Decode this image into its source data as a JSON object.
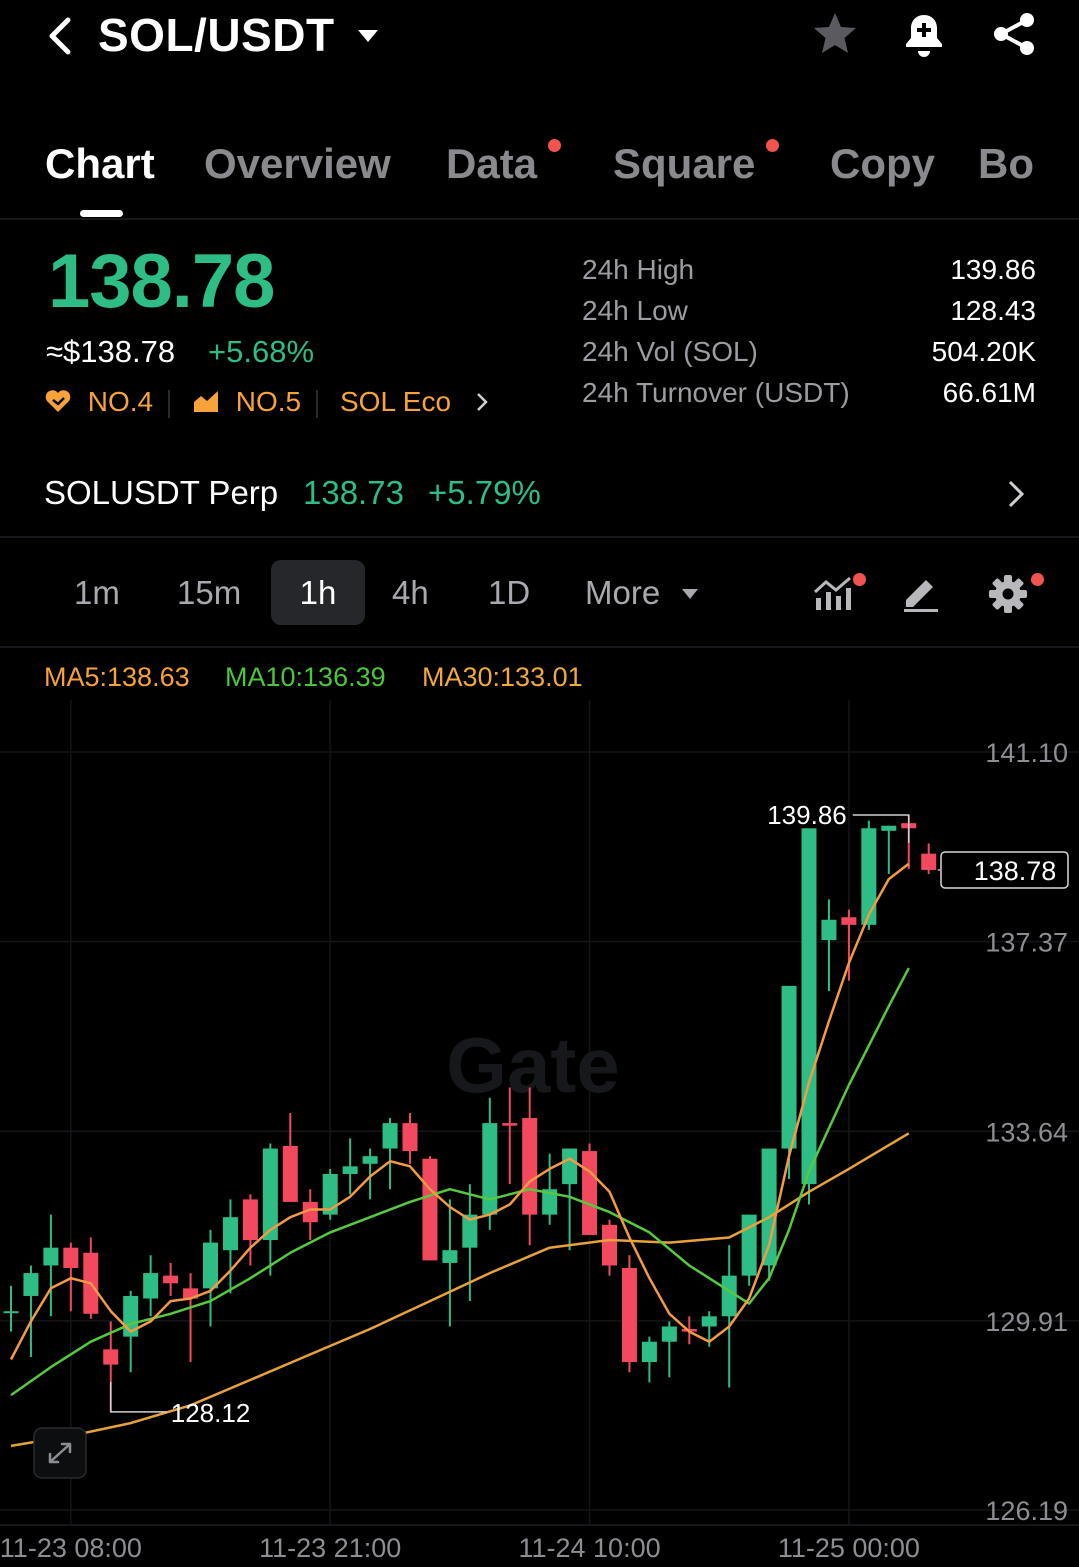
{
  "header": {
    "title": "SOL/USDT",
    "icons": [
      "back-icon",
      "dropdown-caret-icon",
      "star-icon",
      "bell-plus-icon",
      "share-icon"
    ]
  },
  "tabs": [
    {
      "label": "Chart",
      "active": true,
      "dot": false
    },
    {
      "label": "Overview",
      "active": false,
      "dot": false
    },
    {
      "label": "Data",
      "active": false,
      "dot": true
    },
    {
      "label": "Square",
      "active": false,
      "dot": true
    },
    {
      "label": "Copy",
      "active": false,
      "dot": false
    },
    {
      "label": "Bo",
      "active": false,
      "dot": false
    }
  ],
  "ticker": {
    "last_price": "138.78",
    "usd_price": "≈$138.78",
    "change_pct": "+5.68%",
    "badges": [
      {
        "icon": "heart-hand-icon",
        "label": "NO.4"
      },
      {
        "icon": "chart-rise-icon",
        "label": "NO.5"
      },
      {
        "icon": "",
        "label": "SOL Eco"
      }
    ],
    "stats": [
      {
        "label": "24h High",
        "value": "139.86"
      },
      {
        "label": "24h Low",
        "value": "128.43"
      },
      {
        "label": "24h Vol (SOL)",
        "value": "504.20K"
      },
      {
        "label": "24h Turnover (USDT)",
        "value": "66.61M"
      }
    ]
  },
  "perp": {
    "name": "SOLUSDT Perp",
    "price": "138.73",
    "change": "+5.79%"
  },
  "intervals": [
    {
      "label": "1m",
      "selected": false
    },
    {
      "label": "15m",
      "selected": false
    },
    {
      "label": "1h",
      "selected": true
    },
    {
      "label": "4h",
      "selected": false
    },
    {
      "label": "1D",
      "selected": false
    },
    {
      "label": "More",
      "selected": false
    }
  ],
  "chart_tools": [
    "indicators-icon",
    "draw-pencil-icon",
    "settings-gear-icon"
  ],
  "ma_labels": [
    {
      "text": "MA5:138.63",
      "color": "#f7a23b"
    },
    {
      "text": "MA10:136.39",
      "color": "#4cc63a"
    },
    {
      "text": "MA30:133.01",
      "color": "#f2a93b"
    }
  ],
  "colors": {
    "up": "#2ebd85",
    "down": "#f2495e",
    "ma5": "#f29a45",
    "ma10": "#56c940",
    "ma30": "#e8a23a"
  },
  "chart_data": {
    "type": "candlestick",
    "watermark": "Gate",
    "y_ticks": [
      141.1,
      137.37,
      133.64,
      129.91,
      126.19
    ],
    "ylim": [
      126.19,
      141.1
    ],
    "x_tick_labels": [
      "11-23 08:00",
      "11-23 21:00",
      "11-24 10:00",
      "11-25 00:00"
    ],
    "x_tick_index": [
      3,
      16,
      29,
      42
    ],
    "max_label": "139.86",
    "min_label": "128.12",
    "current_price_label": "138.78",
    "ohlc": [
      [
        130.1,
        130.6,
        129.7,
        130.1
      ],
      [
        130.4,
        131.0,
        129.2,
        130.85
      ],
      [
        131.0,
        132.0,
        130.0,
        131.35
      ],
      [
        131.35,
        131.45,
        130.1,
        130.95
      ],
      [
        131.25,
        131.55,
        129.95,
        130.05
      ],
      [
        129.35,
        129.9,
        128.12,
        129.05
      ],
      [
        129.6,
        130.5,
        128.9,
        130.4
      ],
      [
        130.35,
        131.2,
        130.0,
        130.85
      ],
      [
        130.8,
        131.05,
        130.4,
        130.65
      ],
      [
        130.55,
        130.85,
        129.1,
        130.35
      ],
      [
        130.55,
        131.7,
        129.8,
        131.45
      ],
      [
        131.3,
        132.3,
        130.45,
        131.95
      ],
      [
        132.3,
        132.4,
        131.0,
        131.5
      ],
      [
        131.5,
        133.4,
        130.8,
        133.3
      ],
      [
        133.35,
        134.0,
        132.6,
        132.25
      ],
      [
        132.25,
        132.5,
        131.5,
        131.85
      ],
      [
        132.0,
        132.9,
        131.9,
        132.8
      ],
      [
        132.8,
        133.5,
        132.4,
        132.95
      ],
      [
        133.0,
        133.3,
        132.3,
        133.15
      ],
      [
        133.3,
        133.9,
        132.5,
        133.8
      ],
      [
        133.8,
        134.0,
        133.0,
        133.25
      ],
      [
        133.1,
        133.15,
        131.1,
        131.1
      ],
      [
        131.05,
        132.3,
        129.8,
        131.3
      ],
      [
        131.35,
        132.6,
        130.3,
        132.0
      ],
      [
        132.0,
        134.3,
        131.7,
        133.8
      ],
      [
        133.8,
        134.5,
        132.6,
        133.75
      ],
      [
        133.9,
        134.5,
        131.4,
        132.0
      ],
      [
        132.0,
        133.2,
        131.8,
        132.5
      ],
      [
        132.6,
        133.3,
        131.3,
        133.3
      ],
      [
        133.25,
        133.4,
        131.6,
        131.6
      ],
      [
        131.8,
        131.9,
        130.8,
        131.0
      ],
      [
        130.95,
        131.2,
        128.9,
        129.1
      ],
      [
        129.1,
        129.6,
        128.7,
        129.5
      ],
      [
        129.5,
        129.9,
        128.8,
        129.8
      ],
      [
        129.75,
        130.0,
        129.45,
        129.7
      ],
      [
        129.8,
        130.1,
        129.4,
        130.0
      ],
      [
        130.0,
        131.4,
        128.6,
        130.8
      ],
      [
        130.8,
        132.0,
        130.6,
        132.0
      ],
      [
        131.0,
        132.5,
        130.7,
        133.3
      ],
      [
        133.3,
        135.0,
        132.7,
        136.5
      ],
      [
        132.6,
        136.5,
        132.2,
        139.6
      ],
      [
        137.4,
        138.2,
        136.4,
        137.8
      ],
      [
        137.85,
        138.0,
        136.6,
        137.7
      ],
      [
        137.7,
        139.75,
        137.6,
        139.6
      ],
      [
        139.55,
        139.6,
        138.7,
        139.65
      ],
      [
        139.7,
        139.86,
        138.8,
        139.6
      ],
      [
        139.1,
        139.3,
        138.7,
        138.78
      ]
    ],
    "ma5": [
      [
        0,
        129.15
      ],
      [
        1,
        129.9
      ],
      [
        2,
        130.55
      ],
      [
        3,
        130.75
      ],
      [
        4,
        130.65
      ],
      [
        5,
        130.1
      ],
      [
        6,
        129.7
      ],
      [
        7,
        129.9
      ],
      [
        8,
        130.3
      ],
      [
        9,
        130.35
      ],
      [
        10,
        130.5
      ],
      [
        11,
        130.9
      ],
      [
        12,
        131.35
      ],
      [
        13,
        131.7
      ],
      [
        14,
        131.95
      ],
      [
        15,
        132.1
      ],
      [
        16,
        132.1
      ],
      [
        17,
        132.35
      ],
      [
        18,
        132.75
      ],
      [
        19,
        133.05
      ],
      [
        20,
        132.95
      ],
      [
        21,
        132.5
      ],
      [
        22,
        132.15
      ],
      [
        23,
        131.9
      ],
      [
        24,
        132.0
      ],
      [
        25,
        132.2
      ],
      [
        26,
        132.65
      ],
      [
        27,
        132.9
      ],
      [
        28,
        133.1
      ],
      [
        29,
        132.85
      ],
      [
        30,
        132.45
      ],
      [
        31,
        131.55
      ],
      [
        32,
        130.75
      ],
      [
        33,
        130.05
      ],
      [
        34,
        129.7
      ],
      [
        35,
        129.5
      ],
      [
        36,
        129.8
      ],
      [
        37,
        130.35
      ],
      [
        38,
        131.4
      ],
      [
        39,
        133.15
      ],
      [
        40,
        134.6
      ],
      [
        41,
        135.8
      ],
      [
        42,
        136.95
      ],
      [
        43,
        137.9
      ],
      [
        44,
        138.6
      ],
      [
        45,
        138.9
      ]
    ],
    "ma10": [
      [
        0,
        128.45
      ],
      [
        2,
        129.0
      ],
      [
        4,
        129.5
      ],
      [
        6,
        129.85
      ],
      [
        8,
        130.05
      ],
      [
        10,
        130.3
      ],
      [
        12,
        130.75
      ],
      [
        14,
        131.25
      ],
      [
        16,
        131.65
      ],
      [
        18,
        131.95
      ],
      [
        20,
        132.25
      ],
      [
        22,
        132.5
      ],
      [
        24,
        132.3
      ],
      [
        26,
        132.5
      ],
      [
        28,
        132.35
      ],
      [
        30,
        132.05
      ],
      [
        32,
        131.65
      ],
      [
        34,
        131.0
      ],
      [
        36,
        130.5
      ],
      [
        37,
        130.25
      ],
      [
        38,
        130.75
      ],
      [
        39,
        131.7
      ],
      [
        40,
        132.85
      ],
      [
        42,
        134.55
      ],
      [
        44,
        136.1
      ],
      [
        45,
        136.85
      ]
    ],
    "ma30": [
      [
        0,
        127.45
      ],
      [
        3,
        127.65
      ],
      [
        6,
        127.9
      ],
      [
        9,
        128.25
      ],
      [
        12,
        128.75
      ],
      [
        15,
        129.25
      ],
      [
        18,
        129.75
      ],
      [
        21,
        130.3
      ],
      [
        24,
        130.85
      ],
      [
        27,
        131.35
      ],
      [
        30,
        131.5
      ],
      [
        33,
        131.45
      ],
      [
        36,
        131.55
      ],
      [
        38,
        131.95
      ],
      [
        40,
        132.45
      ],
      [
        42,
        132.9
      ],
      [
        45,
        133.6
      ]
    ]
  }
}
